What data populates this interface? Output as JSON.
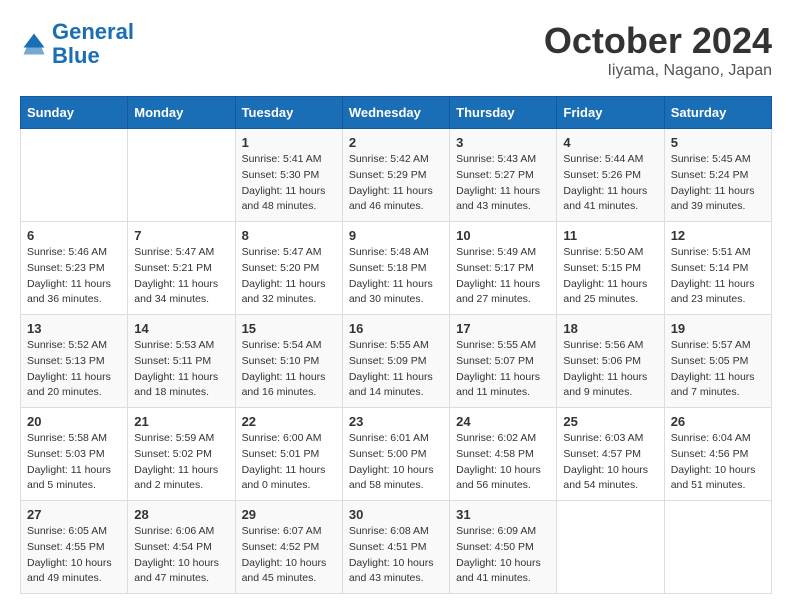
{
  "header": {
    "logo_line1": "General",
    "logo_line2": "Blue",
    "month_title": "October 2024",
    "location": "Iiyama, Nagano, Japan"
  },
  "weekdays": [
    "Sunday",
    "Monday",
    "Tuesday",
    "Wednesday",
    "Thursday",
    "Friday",
    "Saturday"
  ],
  "weeks": [
    [
      {
        "day": "",
        "sunrise": "",
        "sunset": "",
        "daylight": ""
      },
      {
        "day": "",
        "sunrise": "",
        "sunset": "",
        "daylight": ""
      },
      {
        "day": "1",
        "sunrise": "Sunrise: 5:41 AM",
        "sunset": "Sunset: 5:30 PM",
        "daylight": "Daylight: 11 hours and 48 minutes."
      },
      {
        "day": "2",
        "sunrise": "Sunrise: 5:42 AM",
        "sunset": "Sunset: 5:29 PM",
        "daylight": "Daylight: 11 hours and 46 minutes."
      },
      {
        "day": "3",
        "sunrise": "Sunrise: 5:43 AM",
        "sunset": "Sunset: 5:27 PM",
        "daylight": "Daylight: 11 hours and 43 minutes."
      },
      {
        "day": "4",
        "sunrise": "Sunrise: 5:44 AM",
        "sunset": "Sunset: 5:26 PM",
        "daylight": "Daylight: 11 hours and 41 minutes."
      },
      {
        "day": "5",
        "sunrise": "Sunrise: 5:45 AM",
        "sunset": "Sunset: 5:24 PM",
        "daylight": "Daylight: 11 hours and 39 minutes."
      }
    ],
    [
      {
        "day": "6",
        "sunrise": "Sunrise: 5:46 AM",
        "sunset": "Sunset: 5:23 PM",
        "daylight": "Daylight: 11 hours and 36 minutes."
      },
      {
        "day": "7",
        "sunrise": "Sunrise: 5:47 AM",
        "sunset": "Sunset: 5:21 PM",
        "daylight": "Daylight: 11 hours and 34 minutes."
      },
      {
        "day": "8",
        "sunrise": "Sunrise: 5:47 AM",
        "sunset": "Sunset: 5:20 PM",
        "daylight": "Daylight: 11 hours and 32 minutes."
      },
      {
        "day": "9",
        "sunrise": "Sunrise: 5:48 AM",
        "sunset": "Sunset: 5:18 PM",
        "daylight": "Daylight: 11 hours and 30 minutes."
      },
      {
        "day": "10",
        "sunrise": "Sunrise: 5:49 AM",
        "sunset": "Sunset: 5:17 PM",
        "daylight": "Daylight: 11 hours and 27 minutes."
      },
      {
        "day": "11",
        "sunrise": "Sunrise: 5:50 AM",
        "sunset": "Sunset: 5:15 PM",
        "daylight": "Daylight: 11 hours and 25 minutes."
      },
      {
        "day": "12",
        "sunrise": "Sunrise: 5:51 AM",
        "sunset": "Sunset: 5:14 PM",
        "daylight": "Daylight: 11 hours and 23 minutes."
      }
    ],
    [
      {
        "day": "13",
        "sunrise": "Sunrise: 5:52 AM",
        "sunset": "Sunset: 5:13 PM",
        "daylight": "Daylight: 11 hours and 20 minutes."
      },
      {
        "day": "14",
        "sunrise": "Sunrise: 5:53 AM",
        "sunset": "Sunset: 5:11 PM",
        "daylight": "Daylight: 11 hours and 18 minutes."
      },
      {
        "day": "15",
        "sunrise": "Sunrise: 5:54 AM",
        "sunset": "Sunset: 5:10 PM",
        "daylight": "Daylight: 11 hours and 16 minutes."
      },
      {
        "day": "16",
        "sunrise": "Sunrise: 5:55 AM",
        "sunset": "Sunset: 5:09 PM",
        "daylight": "Daylight: 11 hours and 14 minutes."
      },
      {
        "day": "17",
        "sunrise": "Sunrise: 5:55 AM",
        "sunset": "Sunset: 5:07 PM",
        "daylight": "Daylight: 11 hours and 11 minutes."
      },
      {
        "day": "18",
        "sunrise": "Sunrise: 5:56 AM",
        "sunset": "Sunset: 5:06 PM",
        "daylight": "Daylight: 11 hours and 9 minutes."
      },
      {
        "day": "19",
        "sunrise": "Sunrise: 5:57 AM",
        "sunset": "Sunset: 5:05 PM",
        "daylight": "Daylight: 11 hours and 7 minutes."
      }
    ],
    [
      {
        "day": "20",
        "sunrise": "Sunrise: 5:58 AM",
        "sunset": "Sunset: 5:03 PM",
        "daylight": "Daylight: 11 hours and 5 minutes."
      },
      {
        "day": "21",
        "sunrise": "Sunrise: 5:59 AM",
        "sunset": "Sunset: 5:02 PM",
        "daylight": "Daylight: 11 hours and 2 minutes."
      },
      {
        "day": "22",
        "sunrise": "Sunrise: 6:00 AM",
        "sunset": "Sunset: 5:01 PM",
        "daylight": "Daylight: 11 hours and 0 minutes."
      },
      {
        "day": "23",
        "sunrise": "Sunrise: 6:01 AM",
        "sunset": "Sunset: 5:00 PM",
        "daylight": "Daylight: 10 hours and 58 minutes."
      },
      {
        "day": "24",
        "sunrise": "Sunrise: 6:02 AM",
        "sunset": "Sunset: 4:58 PM",
        "daylight": "Daylight: 10 hours and 56 minutes."
      },
      {
        "day": "25",
        "sunrise": "Sunrise: 6:03 AM",
        "sunset": "Sunset: 4:57 PM",
        "daylight": "Daylight: 10 hours and 54 minutes."
      },
      {
        "day": "26",
        "sunrise": "Sunrise: 6:04 AM",
        "sunset": "Sunset: 4:56 PM",
        "daylight": "Daylight: 10 hours and 51 minutes."
      }
    ],
    [
      {
        "day": "27",
        "sunrise": "Sunrise: 6:05 AM",
        "sunset": "Sunset: 4:55 PM",
        "daylight": "Daylight: 10 hours and 49 minutes."
      },
      {
        "day": "28",
        "sunrise": "Sunrise: 6:06 AM",
        "sunset": "Sunset: 4:54 PM",
        "daylight": "Daylight: 10 hours and 47 minutes."
      },
      {
        "day": "29",
        "sunrise": "Sunrise: 6:07 AM",
        "sunset": "Sunset: 4:52 PM",
        "daylight": "Daylight: 10 hours and 45 minutes."
      },
      {
        "day": "30",
        "sunrise": "Sunrise: 6:08 AM",
        "sunset": "Sunset: 4:51 PM",
        "daylight": "Daylight: 10 hours and 43 minutes."
      },
      {
        "day": "31",
        "sunrise": "Sunrise: 6:09 AM",
        "sunset": "Sunset: 4:50 PM",
        "daylight": "Daylight: 10 hours and 41 minutes."
      },
      {
        "day": "",
        "sunrise": "",
        "sunset": "",
        "daylight": ""
      },
      {
        "day": "",
        "sunrise": "",
        "sunset": "",
        "daylight": ""
      }
    ]
  ]
}
